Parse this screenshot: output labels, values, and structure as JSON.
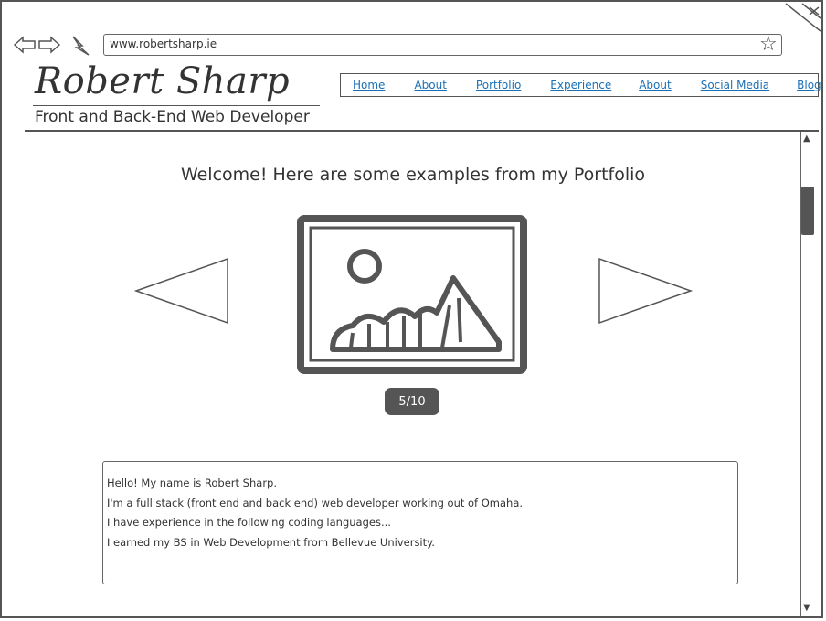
{
  "browser": {
    "url": "www.robertsharp.ie",
    "back_icon": "back-arrow-icon",
    "forward_icon": "forward-arrow-icon",
    "reload_icon": "lightning-reload-icon",
    "bookmark_icon": "star-icon"
  },
  "header": {
    "title": "Robert Sharp",
    "subtitle": "Front and Back-End Web Developer"
  },
  "nav": {
    "items": [
      "Home",
      "About",
      "Portfolio",
      "Experience",
      "About",
      "Social Media",
      "Blog"
    ]
  },
  "main": {
    "welcome": "Welcome! Here are some examples from my Portfolio",
    "carousel": {
      "counter": "5/10",
      "prev_icon": "triangle-left-icon",
      "next_icon": "triangle-right-icon",
      "image_icon": "image-placeholder-icon"
    },
    "bio": {
      "lines": [
        "Hello! My name is Robert Sharp.",
        "I'm a full stack (front end and back end) web developer working out of Omaha.",
        "I have experience in the following coding languages...",
        "I earned my BS in Web Development from Bellevue University."
      ]
    }
  }
}
